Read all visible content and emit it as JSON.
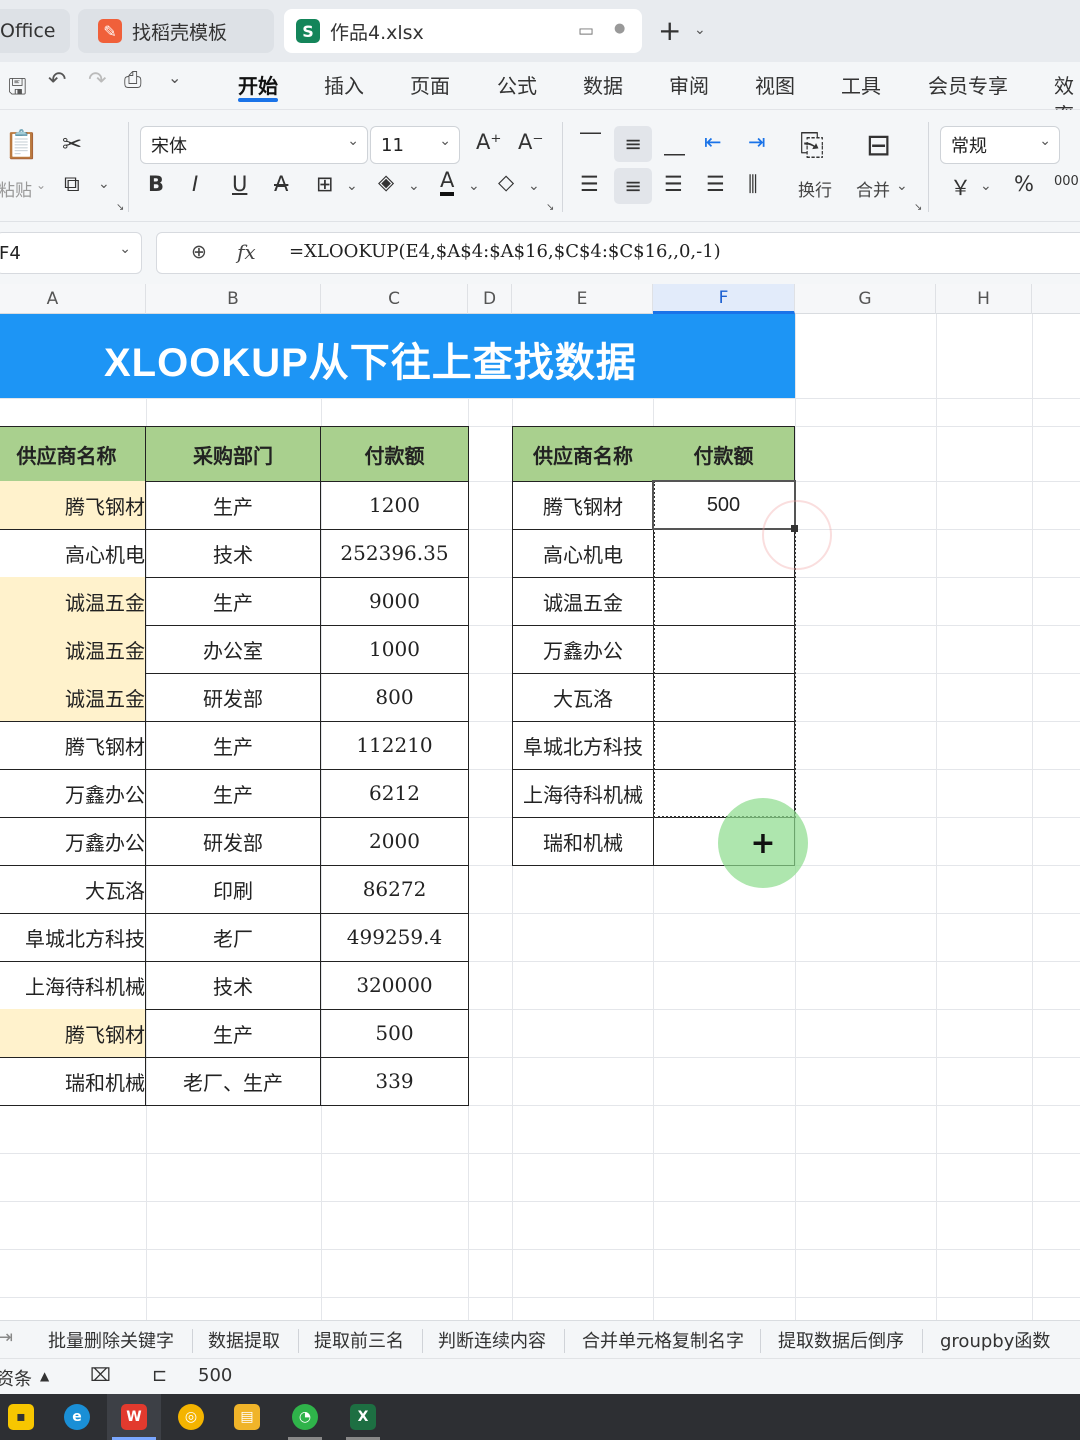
{
  "tabs": [
    {
      "label": "Office",
      "icon": "office-icon"
    },
    {
      "label": "找稻壳模板",
      "icon": "docer-icon"
    },
    {
      "label": "作品4.xlsx",
      "icon": "sheet-icon"
    }
  ],
  "menu": [
    "开始",
    "插入",
    "页面",
    "公式",
    "数据",
    "审阅",
    "视图",
    "工具",
    "会员专享",
    "效率"
  ],
  "menu_active": "开始",
  "toolbar": {
    "paste_label": "粘贴",
    "font_name": "宋体",
    "font_size": "11",
    "wrap_label": "换行",
    "merge_label": "合并",
    "number_format": "常规",
    "currency_symbol": "￥",
    "percent_symbol": "%",
    "thousands_symbol": "000"
  },
  "formula_bar": {
    "name_box": "F4",
    "fx_label": "fx",
    "formula": "=XLOOKUP(E4,$A$4:$A$16,$C$4:$C$16,,0,-1)"
  },
  "columns": [
    "A",
    "B",
    "C",
    "D",
    "E",
    "F",
    "G",
    "H"
  ],
  "selected_column": "F",
  "sheet": {
    "title": "XLOOKUP从下往上查找数据",
    "left_table": {
      "headers": [
        "供应商名称",
        "采购部门",
        "付款额"
      ],
      "rows": [
        {
          "supplier": "腾飞钢材",
          "dept": "生产",
          "amount": "1200",
          "highlight": true
        },
        {
          "supplier": "高心机电",
          "dept": "技术",
          "amount": "252396.35",
          "highlight": false
        },
        {
          "supplier": "诚温五金",
          "dept": "生产",
          "amount": "9000",
          "highlight": true
        },
        {
          "supplier": "诚温五金",
          "dept": "办公室",
          "amount": "1000",
          "highlight": true
        },
        {
          "supplier": "诚温五金",
          "dept": "研发部",
          "amount": "800",
          "highlight": true
        },
        {
          "supplier": "腾飞钢材",
          "dept": "生产",
          "amount": "112210",
          "highlight": false
        },
        {
          "supplier": "万鑫办公",
          "dept": "生产",
          "amount": "6212",
          "highlight": false
        },
        {
          "supplier": "万鑫办公",
          "dept": "研发部",
          "amount": "2000",
          "highlight": false
        },
        {
          "supplier": "大瓦洛",
          "dept": "印刷",
          "amount": "86272",
          "highlight": false
        },
        {
          "supplier": "阜城北方科技",
          "dept": "老厂",
          "amount": "499259.4",
          "highlight": false
        },
        {
          "supplier": "上海待科机械",
          "dept": "技术",
          "amount": "320000",
          "highlight": false
        },
        {
          "supplier": "腾飞钢材",
          "dept": "生产",
          "amount": "500",
          "highlight": true
        },
        {
          "supplier": "瑞和机械",
          "dept": "老厂、生产",
          "amount": "339",
          "highlight": false
        }
      ]
    },
    "right_table": {
      "headers": [
        "供应商名称",
        "付款额"
      ],
      "rows": [
        {
          "supplier": "腾飞钢材",
          "amount": "500"
        },
        {
          "supplier": "高心机电",
          "amount": ""
        },
        {
          "supplier": "诚温五金",
          "amount": ""
        },
        {
          "supplier": "万鑫办公",
          "amount": ""
        },
        {
          "supplier": "大瓦洛",
          "amount": ""
        },
        {
          "supplier": "阜城北方科技",
          "amount": ""
        },
        {
          "supplier": "上海待科机械",
          "amount": ""
        },
        {
          "supplier": "瑞和机械",
          "amount": ""
        }
      ]
    }
  },
  "sheet_tabs": [
    "批量删除关键字",
    "数据提取",
    "提取前三名",
    "判断连续内容",
    "合并单元格复制名字",
    "提取数据后倒序",
    "groupby函数"
  ],
  "status": {
    "left_label": "资条",
    "value": "500"
  },
  "taskbar": [
    "sticky-notes-icon",
    "edge-icon",
    "wps-icon",
    "chrome-icon",
    "file-explorer-icon",
    "wechat-icon",
    "excel-icon"
  ],
  "colors": {
    "title_bg": "#1d95f5",
    "header_bg": "#a9d08e",
    "highlight_bg": "#fff2cc",
    "accent": "#1a73e8"
  }
}
